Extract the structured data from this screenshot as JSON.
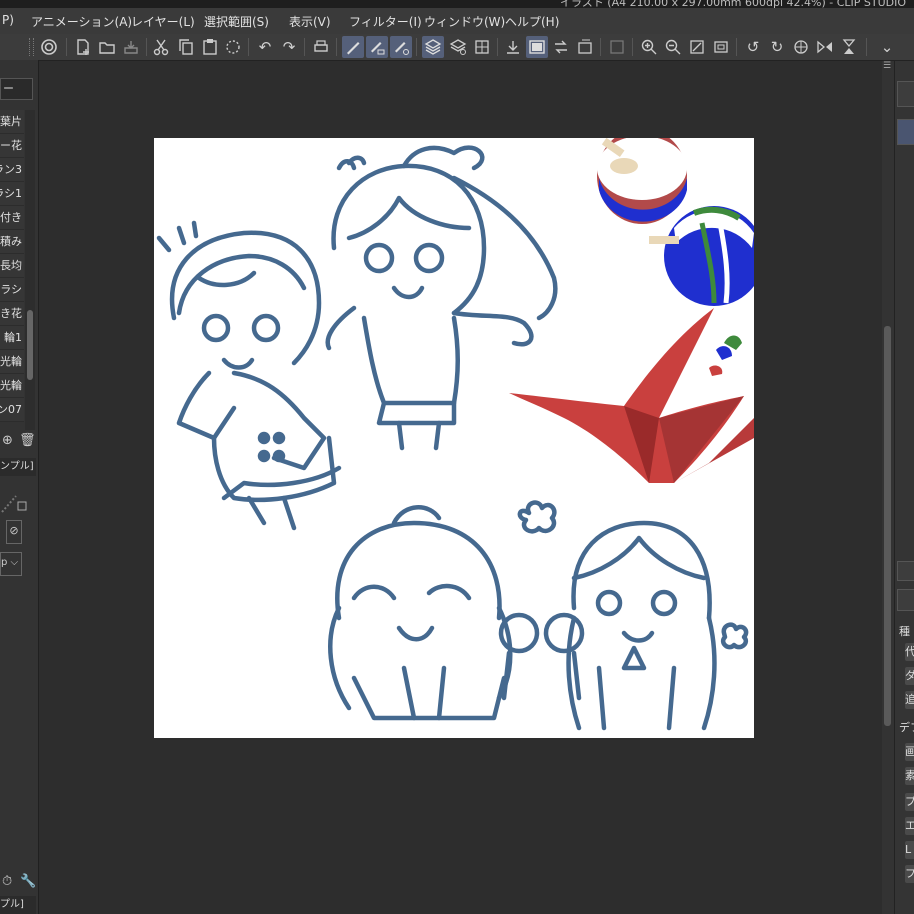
{
  "title_fragment": "イラスト (A4 210.00 x 297.00mm 600dpi 42.4%) - CLIP STUDIO",
  "menu": [
    "P)",
    "アニメーション(A)",
    "レイヤー(L)",
    "選択範囲(S)",
    "表示(V)",
    "フィルター(I)",
    "ウィンドウ(W)",
    "ヘルプ(H)"
  ],
  "left_panel": {
    "header": "ー",
    "brushes": [
      "葉片",
      "ー花",
      "ラン3",
      "ラシ1",
      "付き",
      "積み",
      "長均",
      "ブラシ",
      "き花",
      "輪1",
      "光輪",
      "光輪",
      "ン07"
    ],
    "tab_label": "ンプル]",
    "tab_label2": "プル]",
    "select_value": "p"
  },
  "right_panel": {
    "labels": [
      "種",
      "デフ"
    ],
    "buttons": [
      "代",
      "ダ",
      "追",
      "画",
      "素",
      "プ",
      "エ",
      "L",
      "フ"
    ]
  },
  "colors": {
    "canvas_bg": "#ffffff",
    "line_art": "#45698f",
    "crane": "#c9403e",
    "top_blue": "#1f2fcf",
    "top_green": "#3e8a3c",
    "top_red": "#b24a4a"
  }
}
